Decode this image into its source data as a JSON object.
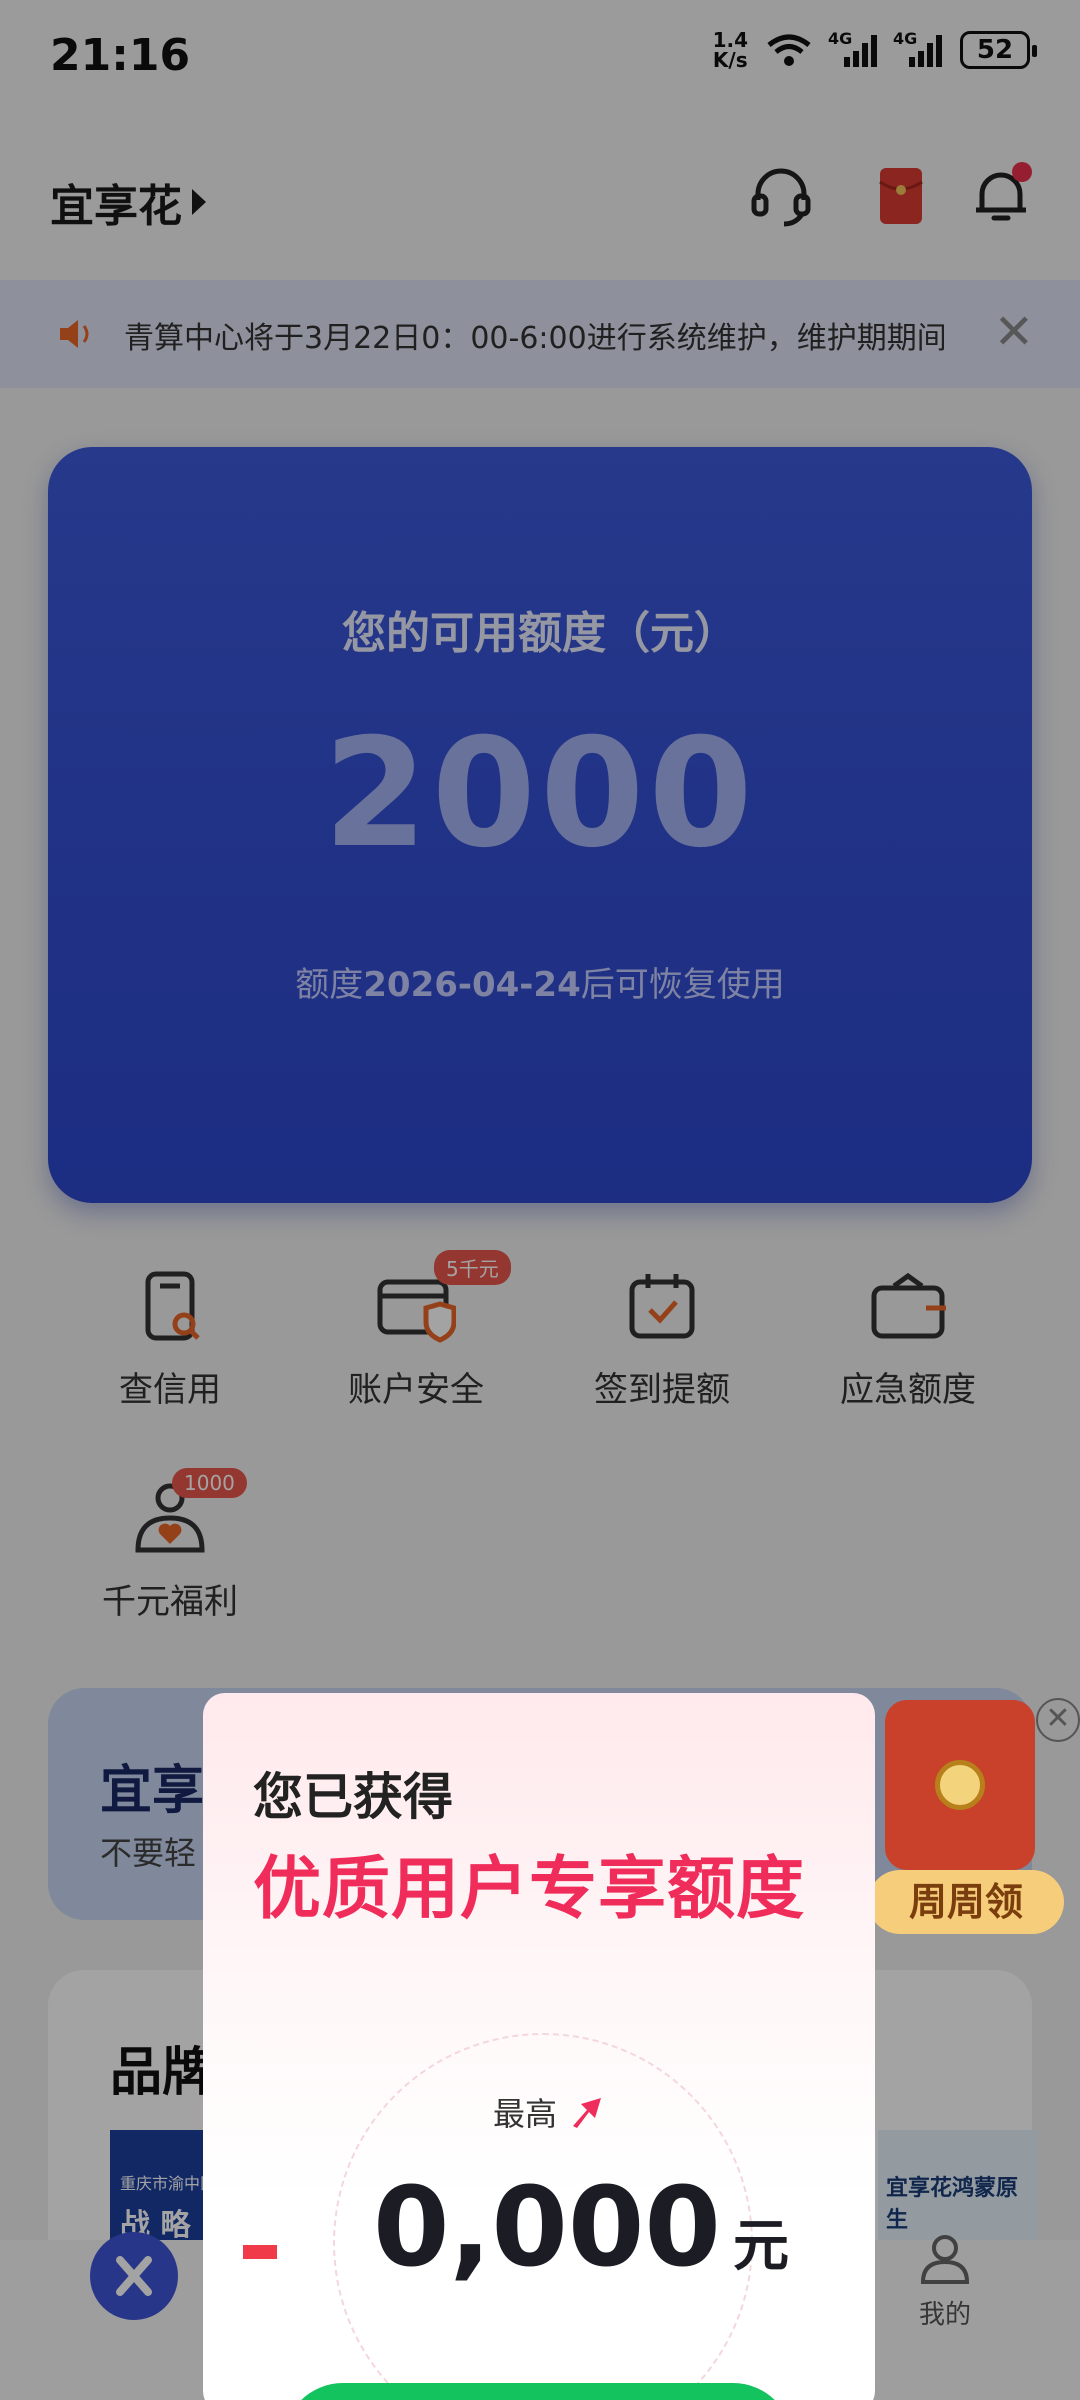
{
  "status_bar": {
    "time": "21:16",
    "net_speed_value": "1.4",
    "net_speed_unit": "K/s",
    "signal1_label": "4G",
    "signal2_label": "4G",
    "battery": "52"
  },
  "header": {
    "title": "宜享花",
    "icons": [
      "headset-icon",
      "red-packet-icon",
      "bell-icon"
    ]
  },
  "notice": {
    "text": "青算中心将于3月22日0：00-6:00进行系统维护，维护期期间"
  },
  "credit": {
    "label": "您的可用额度（元）",
    "amount": "2000",
    "note_prefix": "额度",
    "note_date": "2026-04-24",
    "note_suffix": "后可恢复使用"
  },
  "quick_menu": [
    {
      "label": "查信用",
      "icon": "credit-check-icon"
    },
    {
      "label": "账户安全",
      "icon": "shield-card-icon",
      "badge": "5千元"
    },
    {
      "label": "签到提额",
      "icon": "calendar-check-icon"
    },
    {
      "label": "应急额度",
      "icon": "wallet-icon"
    },
    {
      "label": "千元福利",
      "icon": "heart-user-icon",
      "badge": "1000"
    }
  ],
  "banner": {
    "title": "宜享",
    "subtitle": "不要轻",
    "weekly_button": "周周领"
  },
  "brand": {
    "title": "品牌",
    "left_caption_top": "重庆市渝中区",
    "left_caption_main": "战 略",
    "right_caption": "宜享花鸿蒙原生"
  },
  "bottom_nav": {
    "mine_label": "我的"
  },
  "popup": {
    "subtitle": "您已获得",
    "title": "优质用户专享额度",
    "max_label": "最高",
    "amount": "0,000",
    "unit": "元"
  },
  "colors": {
    "accent_blue": "#3d59d9",
    "popup_pink": "#f02c5a",
    "cta_green": "#13c35d"
  }
}
